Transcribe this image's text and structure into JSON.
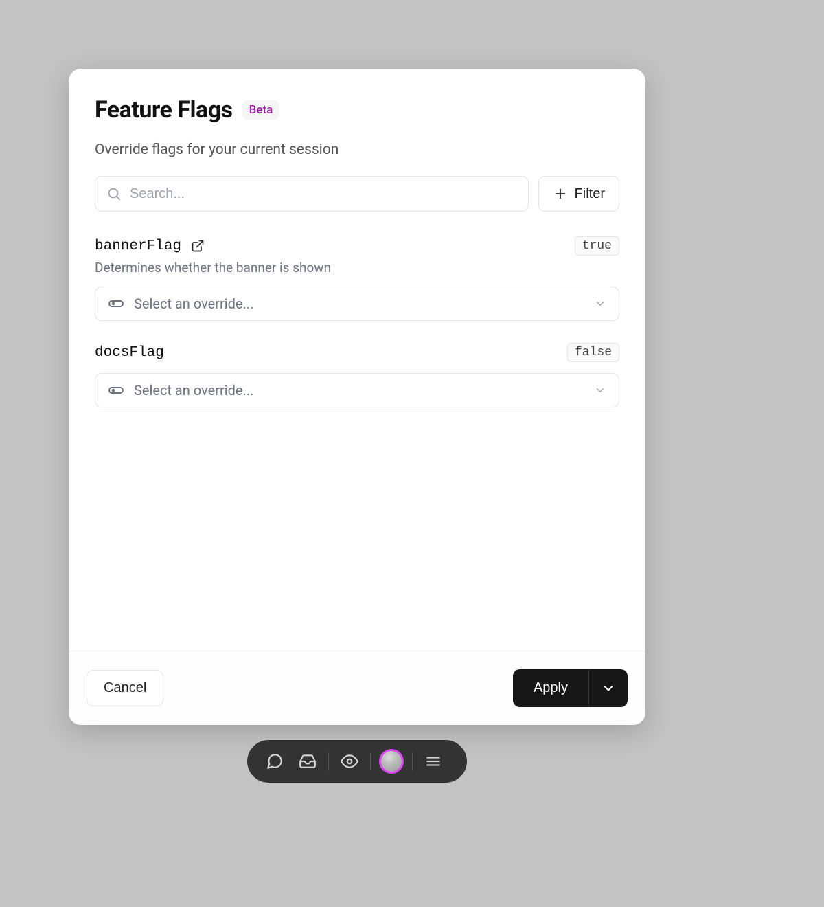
{
  "modal": {
    "title": "Feature Flags",
    "badge": "Beta",
    "subtitle": "Override flags for your current session"
  },
  "search": {
    "placeholder": "Search...",
    "filter_label": "Filter"
  },
  "flags": [
    {
      "name": "bannerFlag",
      "value": "true",
      "has_external": true,
      "description": "Determines whether the banner is shown",
      "override_placeholder": "Select an override..."
    },
    {
      "name": "docsFlag",
      "value": "false",
      "has_external": false,
      "description": "",
      "override_placeholder": "Select an override..."
    }
  ],
  "footer": {
    "cancel": "Cancel",
    "apply": "Apply"
  }
}
